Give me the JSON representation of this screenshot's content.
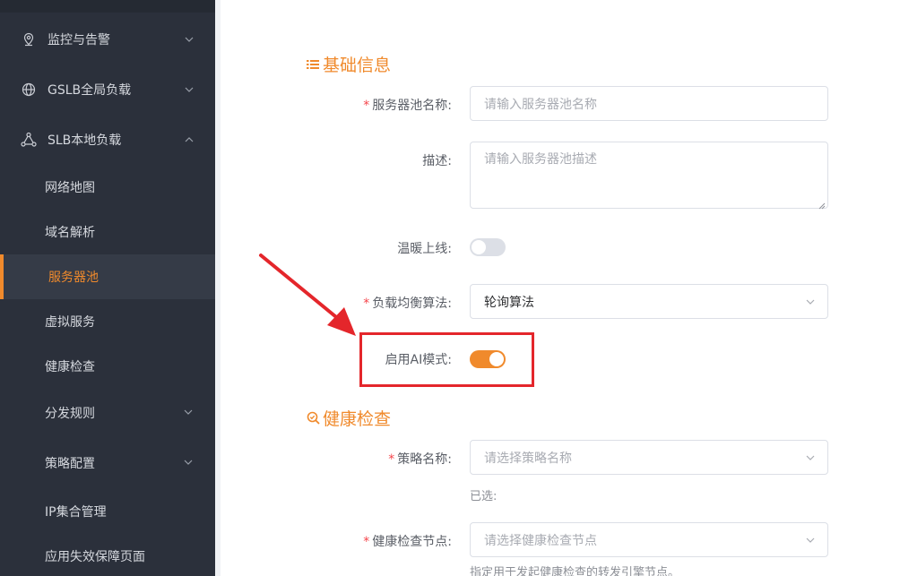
{
  "sidebar": {
    "groups": [
      {
        "label": "监控与告警",
        "icon": "location-pin-icon",
        "expanded": false
      },
      {
        "label": "GSLB全局负载",
        "icon": "globe-icon",
        "expanded": false
      },
      {
        "label": "SLB本地负载",
        "icon": "network-nodes-icon",
        "expanded": true
      }
    ],
    "sub_items": [
      {
        "label": "网络地图"
      },
      {
        "label": "域名解析"
      },
      {
        "label": "服务器池",
        "active": true
      },
      {
        "label": "虚拟服务"
      },
      {
        "label": "健康检查"
      },
      {
        "label": "分发规则",
        "has_children": true
      },
      {
        "label": "策略配置",
        "has_children": true
      },
      {
        "label": "IP集合管理"
      },
      {
        "label": "应用失效保障页面"
      }
    ]
  },
  "form": {
    "basic_section_title": "基础信息",
    "pool_name": {
      "label": "服务器池名称:",
      "required": true,
      "placeholder": "请输入服务器池名称"
    },
    "description": {
      "label": "描述:",
      "required": false,
      "placeholder": "请输入服务器池描述"
    },
    "warm_up": {
      "label": "温暖上线:",
      "on": false
    },
    "algorithm": {
      "label": "负载均衡算法:",
      "required": true,
      "value": "轮询算法"
    },
    "ai_mode": {
      "label": "启用AI模式:",
      "on": true
    },
    "health_section_title": "健康检查",
    "policy_name": {
      "label": "策略名称:",
      "required": true,
      "placeholder": "请选择策略名称",
      "selected_hint": "已选:"
    },
    "check_node": {
      "label": "健康检查节点:",
      "required": true,
      "placeholder": "请选择健康检查节点",
      "hint": "指定用于发起健康检查的转发引擎节点。"
    }
  },
  "colors": {
    "accent": "#f08a2c",
    "sidebar_bg": "#2b303b",
    "annotation_red": "#e4262b"
  }
}
